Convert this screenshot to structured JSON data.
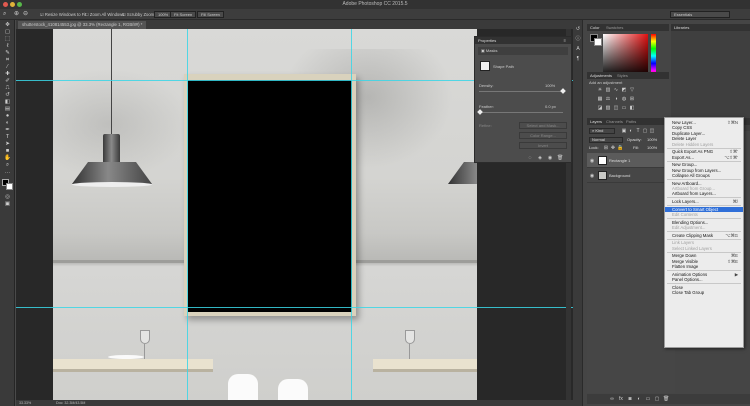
{
  "window": {
    "title": "Adobe Photoshop CC 2015.5"
  },
  "options_bar": {
    "resize_windows_label": "Resize Windows to Fit",
    "zoom_all_label": "Zoom All Windows",
    "scrubby_zoom_label": "Scrubby Zoom",
    "zoom_value": "100%",
    "fit_screen_label": "Fit Screen",
    "fill_screen_label": "Fill Screen",
    "workspace": "Essentials"
  },
  "document": {
    "tab_label": "shutterstock_410814553.jpg @ 33.3% (Rectangle 1, RGB/8#) *",
    "zoom_status": "33.33%",
    "doc_info": "Doc: 32.3M/43.5M"
  },
  "properties": {
    "tab_label": "Properties",
    "section": "Masks",
    "shape_label": "Shape Path",
    "density_label": "Density:",
    "density_value": "100%",
    "feather_label": "Feather:",
    "feather_value": "0.0 px",
    "refine_label": "Refine:",
    "select_mask_label": "Select and Mask...",
    "color_range_label": "Color Range...",
    "invert_label": "Invert"
  },
  "color_panel": {
    "tab_color": "Color",
    "tab_swatches": "Swatches"
  },
  "libraries_panel": {
    "tab": "Libraries"
  },
  "adjustments_panel": {
    "tab_adjustments": "Adjustments",
    "tab_styles": "Styles",
    "hint": "Add an adjustment"
  },
  "layers_panel": {
    "tab_layers": "Layers",
    "tab_channels": "Channels",
    "tab_paths": "Paths",
    "kind_label": "Kind",
    "blend_mode": "Normal",
    "opacity_label": "Opacity:",
    "opacity_value": "100%",
    "fill_label": "Fill:",
    "fill_value": "100%",
    "lock_label": "Lock:",
    "layers": [
      {
        "name": "Rectangle 1"
      },
      {
        "name": "Background"
      }
    ]
  },
  "context_menu": {
    "groups": [
      [
        {
          "label": "New Layer...",
          "shortcut": "⇧⌘N",
          "disabled": false
        },
        {
          "label": "Copy CSS",
          "shortcut": "",
          "disabled": false
        },
        {
          "label": "Duplicate Layer...",
          "shortcut": "",
          "disabled": false
        },
        {
          "label": "Delete Layer",
          "shortcut": "",
          "disabled": false
        },
        {
          "label": "Delete Hidden Layers",
          "shortcut": "",
          "disabled": true
        }
      ],
      [
        {
          "label": "Quick Export As PNG",
          "shortcut": "⇧⌘'",
          "disabled": false
        },
        {
          "label": "Export As...",
          "shortcut": "⌥⇧⌘'",
          "disabled": false
        }
      ],
      [
        {
          "label": "New Group...",
          "shortcut": "",
          "disabled": false
        },
        {
          "label": "New Group from Layers...",
          "shortcut": "",
          "disabled": false
        },
        {
          "label": "Collapse All Groups",
          "shortcut": "",
          "disabled": false
        }
      ],
      [
        {
          "label": "New Artboard...",
          "shortcut": "",
          "disabled": false
        },
        {
          "label": "Artboard from Group...",
          "shortcut": "",
          "disabled": true
        },
        {
          "label": "Artboard from Layers...",
          "shortcut": "",
          "disabled": false
        }
      ],
      [
        {
          "label": "Lock Layers...",
          "shortcut": "⌘/",
          "disabled": false
        }
      ],
      [
        {
          "label": "Convert to Smart Object",
          "shortcut": "",
          "disabled": false,
          "highlighted": true
        },
        {
          "label": "Edit Contents",
          "shortcut": "",
          "disabled": true
        }
      ],
      [
        {
          "label": "Blending Options...",
          "shortcut": "",
          "disabled": false
        },
        {
          "label": "Edit Adjustment...",
          "shortcut": "",
          "disabled": true
        }
      ],
      [
        {
          "label": "Create Clipping Mask",
          "shortcut": "⌥⌘G",
          "disabled": false
        }
      ],
      [
        {
          "label": "Link Layers",
          "shortcut": "",
          "disabled": true
        },
        {
          "label": "Select Linked Layers",
          "shortcut": "",
          "disabled": true
        }
      ],
      [
        {
          "label": "Merge Down",
          "shortcut": "⌘E",
          "disabled": false
        },
        {
          "label": "Merge Visible",
          "shortcut": "⇧⌘E",
          "disabled": false
        },
        {
          "label": "Flatten Image",
          "shortcut": "",
          "disabled": false
        }
      ],
      [
        {
          "label": "Animation Options",
          "shortcut": "▶",
          "disabled": false
        },
        {
          "label": "Panel Options...",
          "shortcut": "",
          "disabled": false
        }
      ],
      [
        {
          "label": "Close",
          "shortcut": "",
          "disabled": false
        },
        {
          "label": "Close Tab Group",
          "shortcut": "",
          "disabled": false
        }
      ]
    ]
  }
}
